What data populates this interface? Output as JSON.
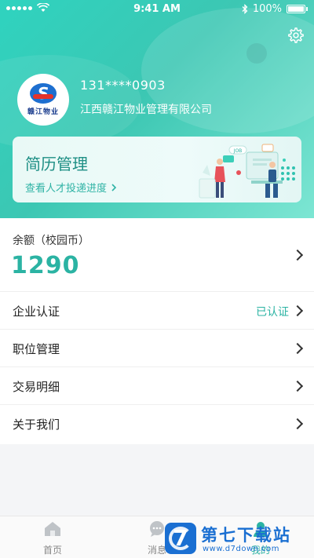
{
  "status_bar": {
    "time": "9:41 AM",
    "battery": "100%"
  },
  "profile": {
    "logo_text": "赣江物业",
    "phone": "131****0903",
    "company": "江西赣江物业管理有限公司"
  },
  "resume_card": {
    "title": "简历管理",
    "link": "查看人才投递进度",
    "illustration_text": "JOB"
  },
  "balance": {
    "label": "余额（校园币）",
    "value": "1290"
  },
  "menu": [
    {
      "label": "企业认证",
      "status": "已认证"
    },
    {
      "label": "职位管理"
    },
    {
      "label": "交易明细"
    },
    {
      "label": "关于我们"
    }
  ],
  "tab_bar": [
    {
      "label": "首页",
      "icon": "home-icon"
    },
    {
      "label": "消息",
      "icon": "message-icon"
    },
    {
      "label": "我的",
      "icon": "profile-icon"
    }
  ],
  "watermark": {
    "title": "第七下载站",
    "url": "www.d7down.com"
  },
  "colors": {
    "accent": "#2bb3a3",
    "header_start": "#2fd3bf",
    "header_end": "#7de6d3"
  }
}
